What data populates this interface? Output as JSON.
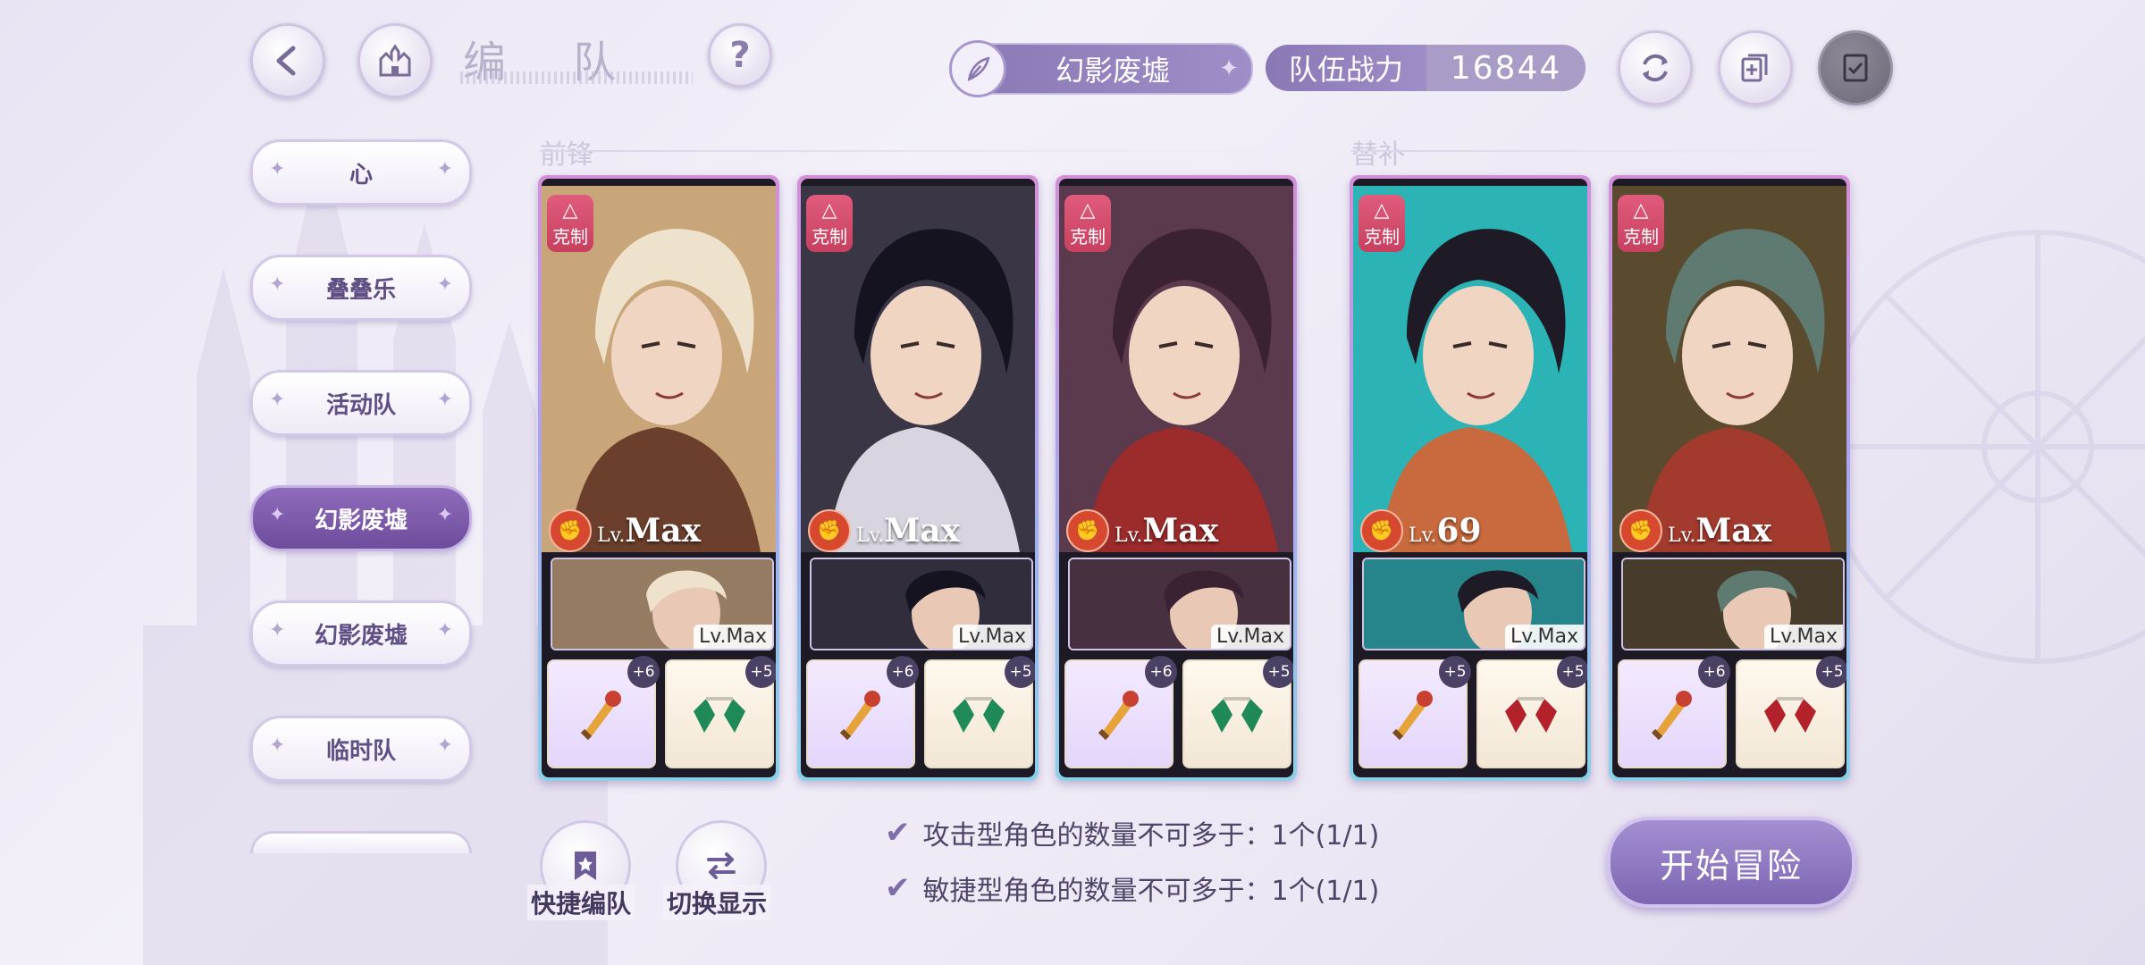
{
  "header": {
    "title": "编 队",
    "mode_name": "幻影废墟",
    "power_label": "队伍战力",
    "power_value": "16844"
  },
  "teams": [
    {
      "label": "心",
      "active": false
    },
    {
      "label": "叠叠乐",
      "active": false
    },
    {
      "label": "活动队",
      "active": false
    },
    {
      "label": "幻影废墟",
      "active": true
    },
    {
      "label": "幻影废墟",
      "active": false
    },
    {
      "label": "临时队",
      "active": false
    }
  ],
  "sections": {
    "front": "前锋",
    "bench": "替补"
  },
  "cards": [
    {
      "badge": "克制",
      "lv_prefix": "Lv.",
      "lv": "Max",
      "sub_lv": "Lv.Max",
      "item1_plus": "+6",
      "item2_plus": "+5",
      "colors": {
        "bg": "#c9a57a",
        "hair": "#efe2cc",
        "accent": "#6b3f2c"
      }
    },
    {
      "badge": "克制",
      "lv_prefix": "Lv.",
      "lv": "Max",
      "sub_lv": "Lv.Max",
      "item1_plus": "+6",
      "item2_plus": "+5",
      "colors": {
        "bg": "#3a3646",
        "hair": "#151320",
        "accent": "#d8d5e0"
      }
    },
    {
      "badge": "克制",
      "lv_prefix": "Lv.",
      "lv": "Max",
      "sub_lv": "Lv.Max",
      "item1_plus": "+6",
      "item2_plus": "+5",
      "colors": {
        "bg": "#5a3a4c",
        "hair": "#3b2233",
        "accent": "#9c2b2b"
      }
    },
    {
      "badge": "克制",
      "lv_prefix": "Lv.",
      "lv": "69",
      "sub_lv": "Lv.Max",
      "item1_plus": "+5",
      "item2_plus": "+5",
      "colors": {
        "bg": "#2bb3b6",
        "hair": "#1e1a26",
        "accent": "#c86a3d"
      }
    },
    {
      "badge": "克制",
      "lv_prefix": "Lv.",
      "lv": "Max",
      "sub_lv": "Lv.Max",
      "item1_plus": "+6",
      "item2_plus": "+5",
      "colors": {
        "bg": "#5a4a2e",
        "hair": "#5f7a70",
        "accent": "#a23a2e"
      }
    }
  ],
  "bottom": {
    "quick_label": "快捷编队",
    "toggle_label": "切换显示",
    "rule1": "攻击型角色的数量不可多于：1个(1/1)",
    "rule2": "敏捷型角色的数量不可多于：1个(1/1)",
    "start_label": "开始冒险"
  },
  "icons": [
    "back-icon",
    "home-castle-icon",
    "help-icon",
    "feather-icon",
    "refresh-icon",
    "copy-add-icon",
    "clipboard-check-icon",
    "bookmark-star-icon",
    "swap-icon",
    "check-icon"
  ]
}
